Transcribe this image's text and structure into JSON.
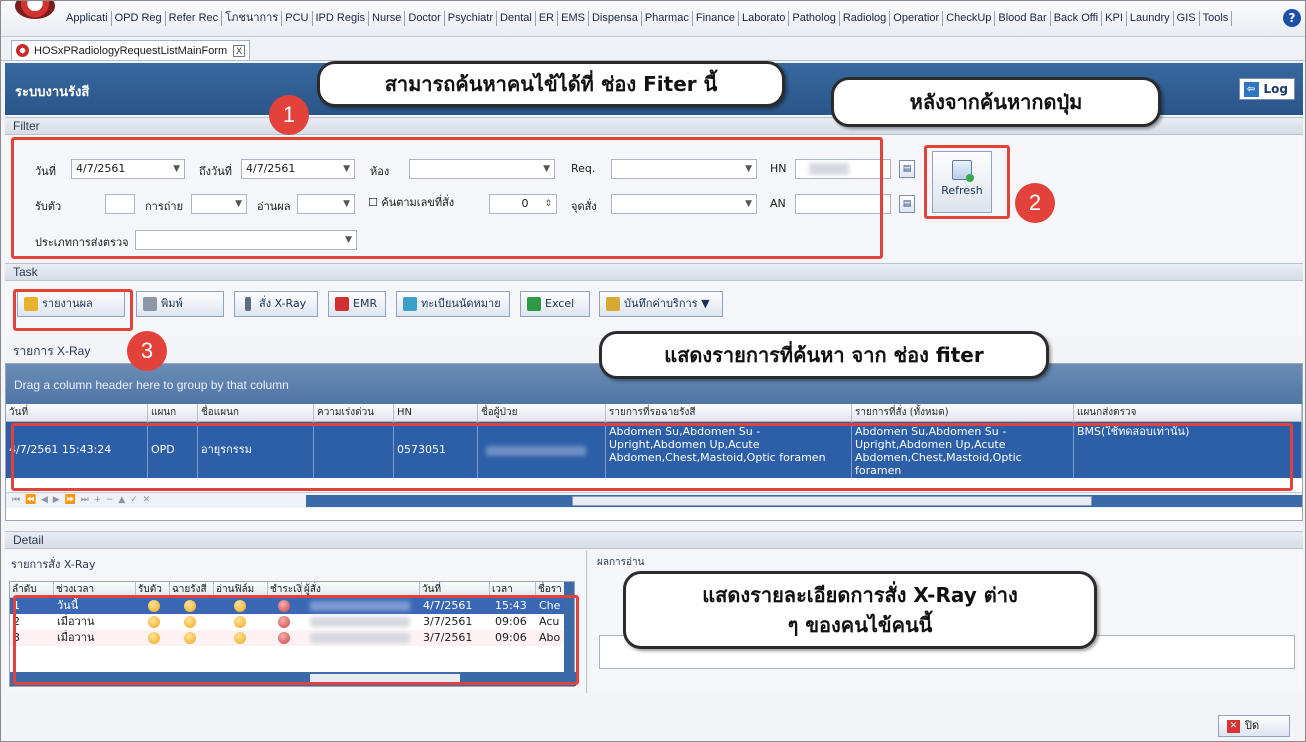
{
  "menu": {
    "items": [
      "Applicati",
      "OPD Reg",
      "Refer Rec",
      "โภชนาการ",
      "PCU",
      "IPD Regis",
      "Nurse",
      "Doctor",
      "Psychiatr",
      "Dental",
      "ER",
      "EMS",
      "Dispensa",
      "Pharmac",
      "Finance",
      "Laborato",
      "Patholog",
      "Radiolog",
      "Operatior",
      "CheckUp",
      "Blood Bar",
      "Back Offi",
      "KPI",
      "Laundry",
      "GIS",
      "Tools"
    ]
  },
  "tab": {
    "title": "HOSxPRadiologyRequestListMainForm",
    "close": "X"
  },
  "header": {
    "title": "ระบบงานรังสี",
    "log_label": "Log"
  },
  "filter": {
    "section": "Filter",
    "date_label": "วันที่",
    "date_value": "4/7/2561",
    "to_date_label": "ถึงวันที่",
    "to_date_value": "4/7/2561",
    "room_label": "ห้อง",
    "req_label": "Req.",
    "hn_label": "HN",
    "receive_label": "รับตัว",
    "shoot_label": "การถ่าย",
    "read_label": "อ่านผล",
    "search_by_order_label": "ค้นตามเลขที่สั่ง",
    "order_number": "0",
    "order_point_label": "จุดสั่ง",
    "an_label": "AN",
    "exam_type_label": "ประเภทการส่งตรวจ",
    "refresh_label": "Refresh"
  },
  "task": {
    "section": "Task",
    "buttons": [
      "รายงานผล",
      "พิมพ์",
      "สั่ง X-Ray",
      "EMR",
      "ทะเบียนนัดหมาย",
      "Excel",
      "บันทึกค่าบริการ"
    ]
  },
  "xray_list": {
    "section": "รายการ X-Ray",
    "group_hint": "Drag a column header here to group by that column",
    "columns": [
      "วันที่",
      "แผนก",
      "ชื่อแผนก",
      "ความเร่งด่วน",
      "HN",
      "ชื่อผู้ป่วย",
      "รายการที่รอฉายรังสี",
      "รายการที่สั่ง (ทั้งหมด)",
      "แผนกส่งตรวจ"
    ],
    "row": {
      "date": "4/7/2561 15:43:24",
      "dept": "OPD",
      "dept_name": "อายุรกรรม",
      "urgency": "",
      "hn": "0573051",
      "pending_items": "Abdomen Su,Abdomen Su - Upright,Abdomen Up,Acute Abdomen,Chest,Mastoid,Optic foramen",
      "ordered_items": "Abdomen Su,Abdomen Su - Upright,Abdomen Up,Acute Abdomen,Chest,Mastoid,Optic foramen",
      "send_dept": "BMS(ใช้ทดสอบเท่านั้น)"
    }
  },
  "detail": {
    "section": "Detail",
    "orders_title": "รายการสั่ง X-Ray",
    "columns": [
      "ลำดับ",
      "ช่วงเวลา",
      "รับตัว",
      "ฉายรังสี",
      "อ่านฟิล์ม",
      "ชำระเงิน",
      "ผู้สั่ง",
      "วันที่",
      "เวลา",
      "ชื่อรา"
    ],
    "rows": [
      {
        "no": "1",
        "period": "วันนี้",
        "date": "4/7/2561",
        "time": "15:43",
        "name": "Che"
      },
      {
        "no": "2",
        "period": "เมื่อวาน",
        "date": "3/7/2561",
        "time": "09:06",
        "name": "Acu"
      },
      {
        "no": "3",
        "period": "เมื่อวาน",
        "date": "3/7/2561",
        "time": "09:06",
        "name": "Abo"
      }
    ],
    "results_title": "ผลการอ่าน",
    "close_label": "ปิด"
  },
  "annotations": {
    "filter_callout": "สามารถค้นหาคนไข้ได้ที่ ช่อง Fiter นี้",
    "refresh_callout": "หลังจากค้นหากดปุ่ม",
    "list_callout": "แสดงรายการที่ค้นหา จาก ช่อง fiter",
    "detail_callout_line1": "แสดงรายละเอียดการสั่ง X-Ray ต่าง",
    "detail_callout_line2": "ๆ ของคนไข้คนนี้",
    "badge1": "1",
    "badge2": "2",
    "badge3": "3"
  },
  "colors": {
    "annotation_red": "#e3423a",
    "header_blue": "#2a5588",
    "selection_blue": "#2d5fa8"
  }
}
